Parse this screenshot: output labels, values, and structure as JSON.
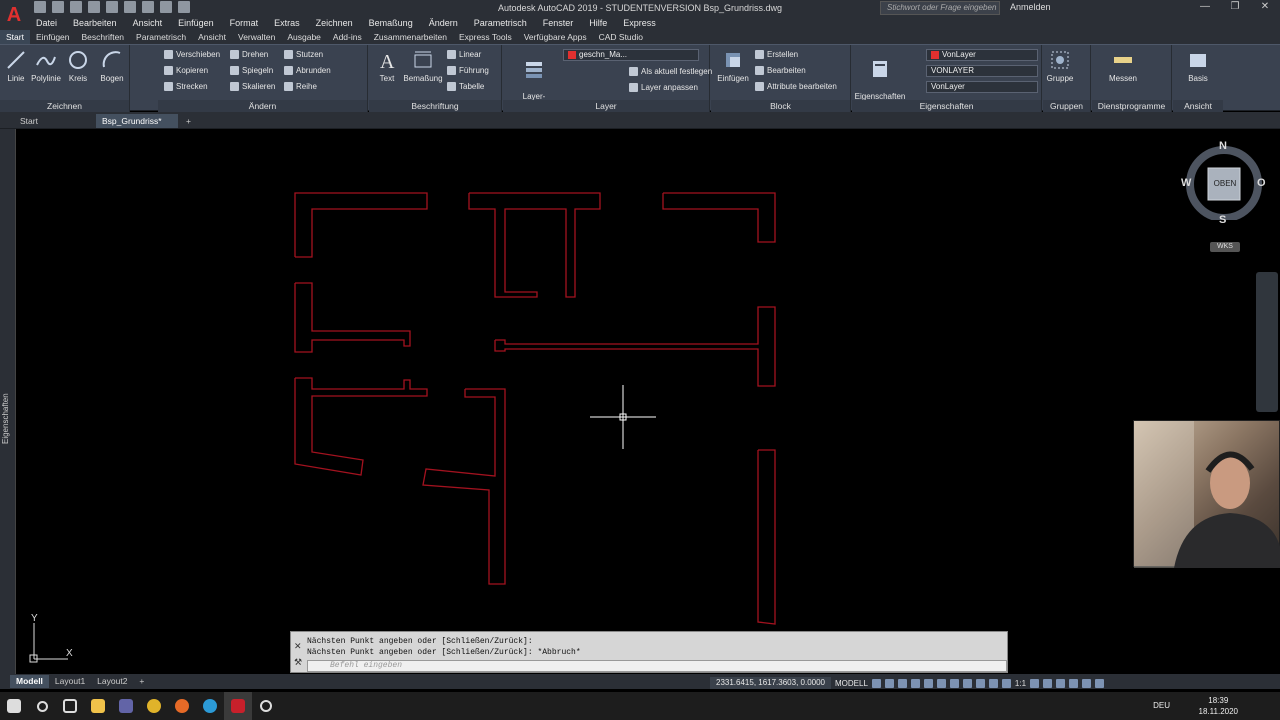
{
  "title": {
    "app_logo": "A",
    "window_title": "Autodesk AutoCAD 2019 - STUDENTENVERSION    Bsp_Grundriss.dwg",
    "search_placeholder": "Stichwort oder Frage eingeben",
    "user": "Anmelden"
  },
  "menu": [
    "Datei",
    "Bearbeiten",
    "Ansicht",
    "Einfügen",
    "Format",
    "Extras",
    "Zeichnen",
    "Bemaßung",
    "Ändern",
    "Parametrisch",
    "Fenster",
    "Hilfe",
    "Express"
  ],
  "ribbon_tabs": [
    "Start",
    "Einfügen",
    "Beschriften",
    "Parametrisch",
    "Ansicht",
    "Verwalten",
    "Ausgabe",
    "Add-ins",
    "Zusammenarbeiten",
    "Express Tools",
    "Verfügbare Apps",
    "CAD Studio"
  ],
  "ribbon": {
    "zeichnen": {
      "title": "Zeichnen",
      "linie": "Linie",
      "polylinie": "Polylinie",
      "kreis": "Kreis",
      "bogen": "Bogen"
    },
    "aendern": {
      "title": "Ändern",
      "verschieben": "Verschieben",
      "drehen": "Drehen",
      "stutzen": "Stutzen",
      "kopieren": "Kopieren",
      "spiegeln": "Spiegeln",
      "abrunden": "Abrunden",
      "strecken": "Strecken",
      "skalieren": "Skalieren",
      "reihe": "Reihe"
    },
    "beschriftung": {
      "title": "Beschriftung",
      "text": "Text",
      "bemassung": "Bemaßung",
      "linear": "Linear",
      "fuehrung": "Führung",
      "tabelle": "Tabelle"
    },
    "layer": {
      "title": "Layer",
      "eigenschaften": "Layer-\nEigenschaften",
      "current_layer": "geschn_Ma...",
      "aktuell": "Als aktuell festlegen",
      "anpassen": "Layer anpassen"
    },
    "block": {
      "title": "Block",
      "einfuegen": "Einfügen",
      "erstellen": "Erstellen",
      "bearbeiten": "Bearbeiten",
      "attribute": "Attribute bearbeiten"
    },
    "eigenschaften": {
      "title": "Eigenschaften",
      "anpassen": "Eigenschaften\nanpassen",
      "color": "VonLayer",
      "linetype": "VONLAYER",
      "lineweight": "VonLayer"
    },
    "gruppen": {
      "title": "Gruppen",
      "gruppe": "Gruppe"
    },
    "dienstprogramme": {
      "title": "Dienstprogramme",
      "messen": "Messen"
    },
    "ansicht": {
      "title": "Ansicht",
      "basis": "Basis"
    }
  },
  "doc_tabs": [
    "Start",
    "Bsp_Grundriss*"
  ],
  "side_palette_label": "Eigenschaften",
  "viewcube": {
    "n": "N",
    "s": "S",
    "w": "W",
    "o": "O",
    "face": "OBEN",
    "wcs": "WKS"
  },
  "ucs": {
    "x": "X",
    "y": "Y"
  },
  "command": {
    "history": [
      "Nächsten Punkt angeben oder [Schließen/Zurück]:",
      "Nächsten Punkt angeben oder [Schließen/Zurück]: *Abbruch*"
    ],
    "placeholder": "Befehl eingeben"
  },
  "layout_tabs": [
    "Modell",
    "Layout1",
    "Layout2"
  ],
  "status": {
    "coords": "2331.6415, 1617.3603, 0.0000",
    "mode": "MODELL",
    "scale": "1:1"
  },
  "taskbar": {
    "lang": "DEU",
    "time": "18:39",
    "date": "18.11.2020"
  },
  "colors": {
    "wall": "#a3121f",
    "accent": "#e0302f",
    "ribbon": "#3a4250"
  }
}
